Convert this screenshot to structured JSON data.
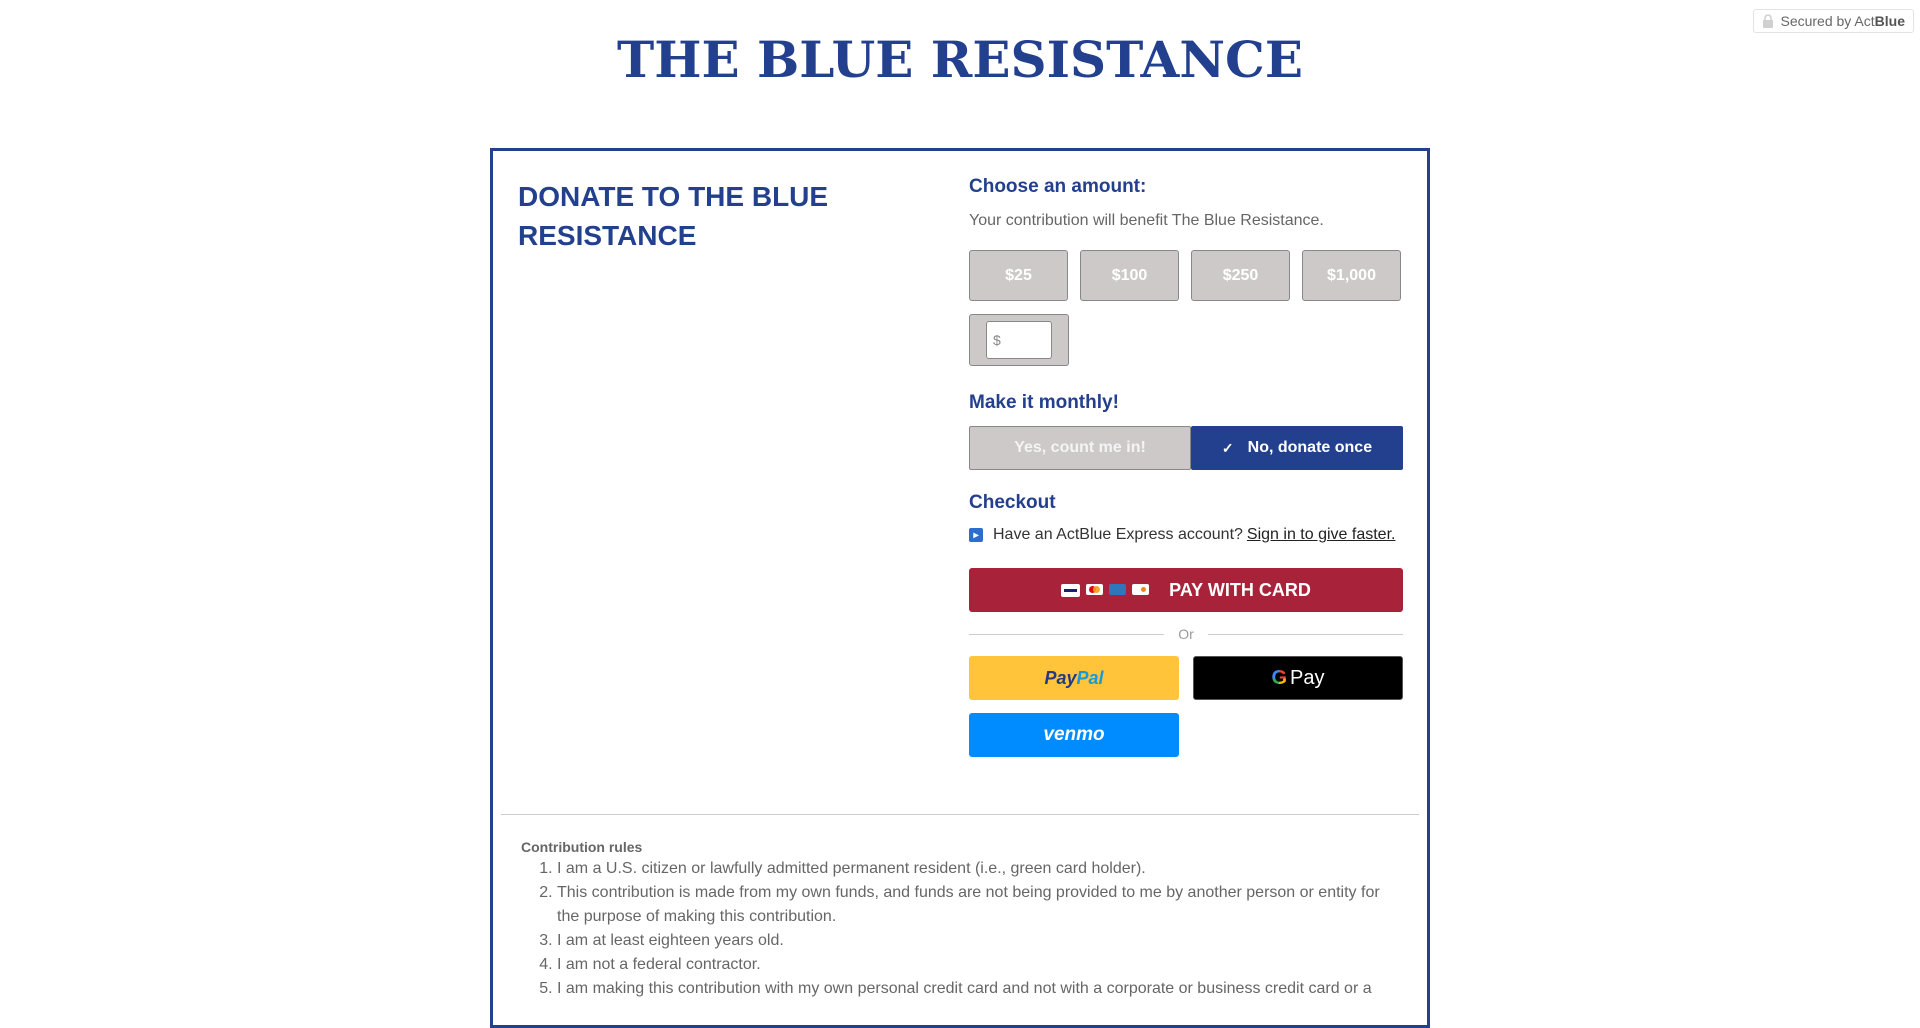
{
  "secured": {
    "prefix": "Secured by Act",
    "brand": "Blue"
  },
  "site_title": "THE BLUE RESISTANCE",
  "card": {
    "left_title": "DONATE TO THE BLUE RESISTANCE",
    "choose_amount": "Choose an amount:",
    "benefit": "Your contribution will benefit The Blue Resistance.",
    "amounts": [
      "$25",
      "$100",
      "$250",
      "$1,000"
    ],
    "custom_amount": {
      "currency_symbol": "$",
      "value": "",
      "placeholder": ""
    },
    "monthly": {
      "title": "Make it monthly!",
      "yes_label": "Yes, count me in!",
      "no_label": "No, donate once",
      "selected": "no"
    },
    "checkout": {
      "title": "Checkout",
      "express_text": "Have an ActBlue Express account?",
      "signin_link": "Sign in to give faster.",
      "pay_card_label": "PAY WITH CARD",
      "or_label": "Or",
      "paypal_part1": "Pay",
      "paypal_part2": "Pal",
      "gpay_g": "G",
      "gpay_label": "Pay",
      "venmo_label": "venmo"
    },
    "rules": {
      "title": "Contribution rules",
      "items": [
        "I am a U.S. citizen or lawfully admitted permanent resident (i.e., green card holder).",
        "This contribution is made from my own funds, and funds are not being provided to me by another person or entity for the purpose of making this contribution.",
        "I am at least eighteen years old.",
        "I am not a federal contractor.",
        "I am making this contribution with my own personal credit card and not with a corporate or business credit card or a"
      ]
    }
  },
  "colors": {
    "brand_blue": "#23408e",
    "pay_red": "#a8233a",
    "paypal_yellow": "#ffc439",
    "venmo_blue": "#008cff"
  }
}
